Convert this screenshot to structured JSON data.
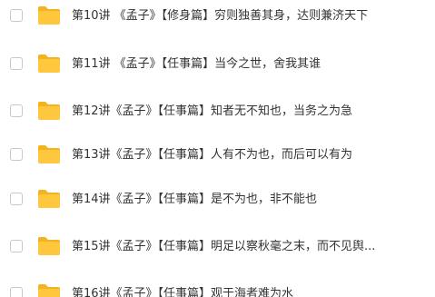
{
  "files": [
    {
      "name": "第10讲 《孟子》【修身篇】穷则独善其身，达则兼济天下",
      "icon": "folder-icon"
    },
    {
      "name": "第11讲 《孟子》【任事篇】当今之世，舍我其谁",
      "icon": "folder-icon"
    },
    {
      "name": "第12讲《孟子》【任事篇】知者无不知也，当务之为急",
      "icon": "folder-icon"
    },
    {
      "name": "第13讲《孟子》【任事篇】人有不为也，而后可以有为",
      "icon": "folder-icon"
    },
    {
      "name": "第14讲《孟子》【任事篇】是不为也，非不能也",
      "icon": "folder-icon"
    },
    {
      "name": "第15讲《孟子》【任事篇】明足以察秋毫之末，而不见舆...",
      "icon": "folder-icon"
    },
    {
      "name": "第16讲《孟子》【任事篇】观于海者难为水",
      "icon": "folder-icon"
    }
  ],
  "colors": {
    "folder": "#FFC73D",
    "folder_tab": "#F5B21F",
    "text": "#333333",
    "checkbox_border": "#C8C8C8"
  }
}
